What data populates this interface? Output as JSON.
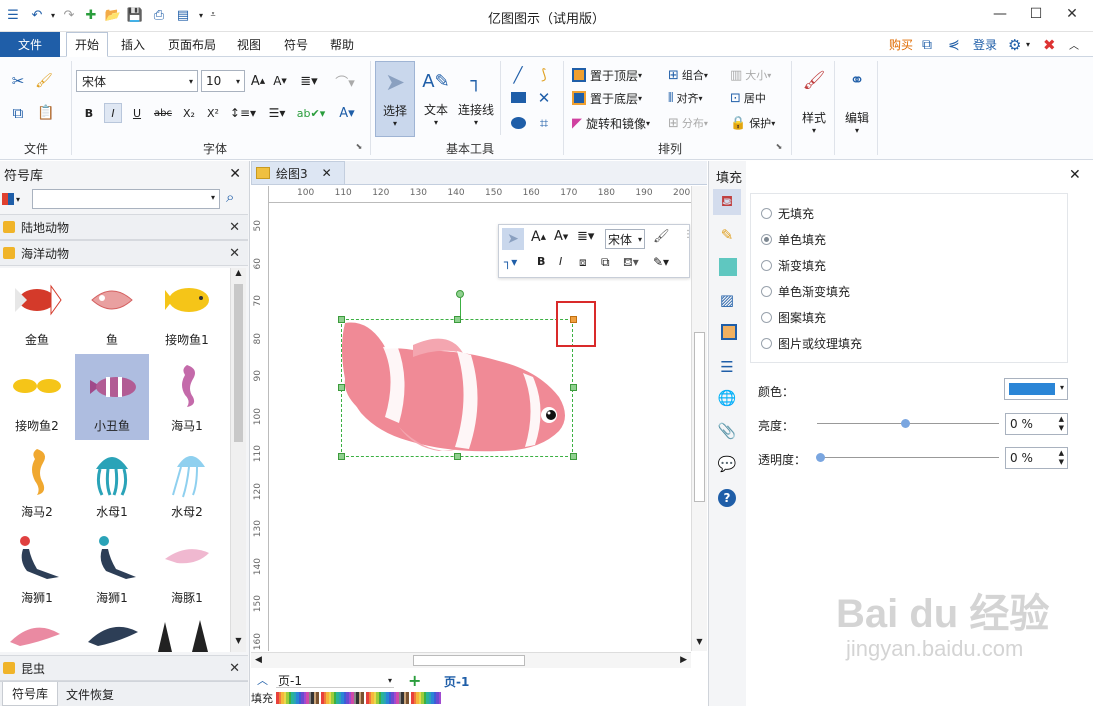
{
  "app": {
    "title": "亿图图示（试用版）"
  },
  "menu": {
    "file": "文件",
    "tabs": [
      "开始",
      "插入",
      "页面布局",
      "视图",
      "符号",
      "帮助"
    ],
    "right": {
      "buy": "购买",
      "login": "登录"
    }
  },
  "ribbon": {
    "font_name": "宋体",
    "font_size": "10",
    "groups": {
      "file": "文件",
      "font": "字体",
      "basic_tools": "基本工具",
      "arrange": "排列"
    },
    "tools": {
      "select": "选择",
      "text": "文本",
      "connector": "连接线"
    },
    "arrange": {
      "bring_front": "置于顶层",
      "send_back": "置于底层",
      "rotate_mirror": "旋转和镜像",
      "group": "组合",
      "align": "对齐",
      "distribute": "分布",
      "size": "大小",
      "center": "居中",
      "protect": "保护"
    },
    "style": "样式",
    "edit": "编辑"
  },
  "library": {
    "title": "符号库",
    "search_placeholder": "",
    "categories": [
      "陆地动物",
      "海洋动物"
    ],
    "bottom_category": "昆虫",
    "symbols": [
      "金鱼",
      "鱼",
      "接吻鱼1",
      "接吻鱼2",
      "小丑鱼",
      "海马1",
      "海马2",
      "水母1",
      "水母2",
      "海狮1",
      "海狮1",
      "海豚1"
    ],
    "tabs": [
      "符号库",
      "文件恢复"
    ]
  },
  "document": {
    "tab": "绘图3",
    "hruler": [
      "100",
      "110",
      "120",
      "130",
      "140",
      "150",
      "160",
      "170",
      "180",
      "190",
      "200"
    ],
    "vruler": [
      "50",
      "60",
      "70",
      "80",
      "90",
      "100",
      "110",
      "120",
      "130",
      "140",
      "150",
      "160"
    ],
    "floating_toolbar": {
      "font": "宋体"
    },
    "page_name": "页-1",
    "page_tab": "页-1",
    "fill_label": "填充"
  },
  "fill_panel": {
    "title": "填充",
    "options": [
      "无填充",
      "单色填充",
      "渐变填充",
      "单色渐变填充",
      "图案填充",
      "图片或纹理填充"
    ],
    "selected_option": "单色填充",
    "color_label": "颜色：",
    "color_value": "#2a85d6",
    "brightness_label": "亮度：",
    "brightness_value": "0 %",
    "transparency_label": "透明度：",
    "transparency_value": "0 %"
  },
  "watermark": {
    "brand": "Bai du 经验",
    "url": "jingyan.baidu.com"
  }
}
